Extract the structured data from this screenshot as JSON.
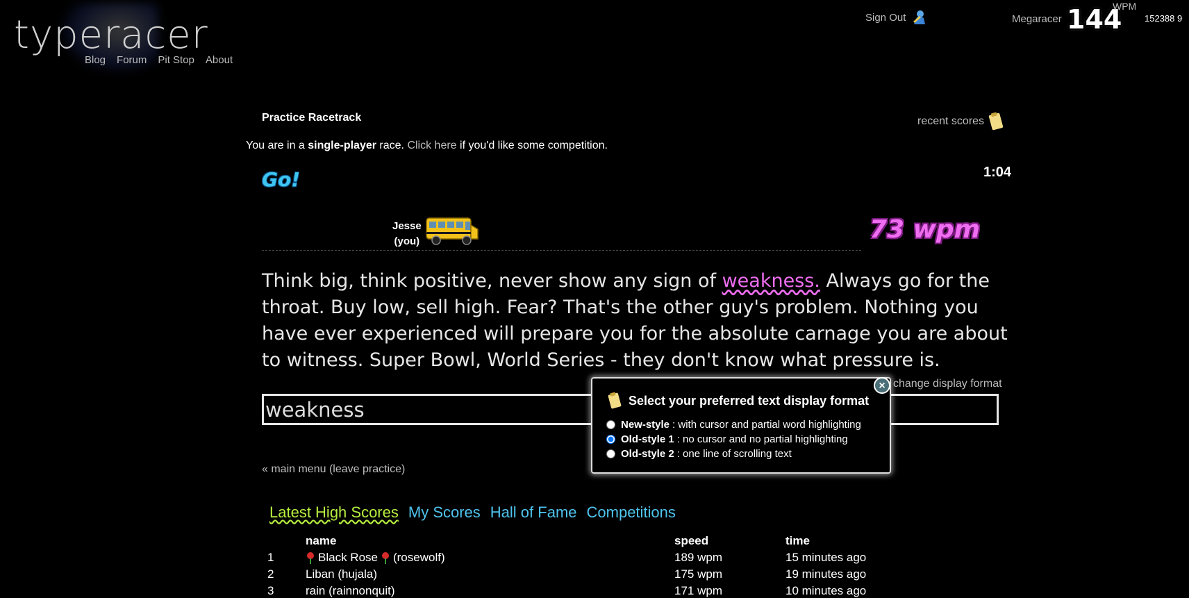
{
  "header": {
    "logo": "typeracer",
    "nav": [
      "Blog",
      "Forum",
      "Pit Stop",
      "About"
    ],
    "sign_out": "Sign Out",
    "username": "Megaracer",
    "wpm_value": "144",
    "wpm_label": "WPM",
    "points": "152388  9"
  },
  "race": {
    "title": "Practice Racetrack",
    "recent_scores": "recent scores",
    "single_prefix": "You are in a ",
    "single_bold": "single-player",
    "single_mid": " race. ",
    "click_here": "Click here",
    "single_suffix": " if you'd like some competition.",
    "go": "Go!",
    "timer": "1:04",
    "racer_name": "Jesse",
    "racer_you": "(you)",
    "speed": "73 wpm",
    "passage_before": "Think big, think positive, never show any sign of ",
    "passage_current": "weakness.",
    "passage_after": " Always go for the throat. Buy low, sell high. Fear? That's the other guy's problem. Nothing you have ever experienced will prepare you for the absolute carnage you are about to witness. Super Bowl, World Series - they don't know what pressure is.",
    "change_format": "change display format",
    "input_value": "weakness",
    "leave": "« main menu (leave practice)"
  },
  "format_popup": {
    "title": "Select your preferred text display format",
    "options": [
      {
        "name": "New-style",
        "desc": ": with cursor and partial word highlighting",
        "selected": false
      },
      {
        "name": "Old-style 1",
        "desc": ": no cursor and no partial highlighting",
        "selected": true
      },
      {
        "name": "Old-style 2",
        "desc": ": one line of scrolling text",
        "selected": false
      }
    ],
    "close": "×"
  },
  "scores": {
    "tabs": [
      "Latest High Scores",
      "My Scores",
      "Hall of Fame",
      "Competitions"
    ],
    "columns": [
      "name",
      "speed",
      "time"
    ],
    "rows": [
      {
        "rank": "1",
        "name": "Black Rose",
        "handle": "(rosewolf)",
        "speed": "189 wpm",
        "time": "15 minutes ago"
      },
      {
        "rank": "2",
        "name": "Liban (hujala)",
        "handle": "",
        "speed": "175 wpm",
        "time": "19 minutes ago"
      },
      {
        "rank": "3",
        "name": "rain (rainnonquit)",
        "handle": "",
        "speed": "171 wpm",
        "time": "10 minutes ago"
      }
    ]
  },
  "colors": {
    "background": "#000000",
    "go": "#3ec6f0",
    "speed": "#ef6df0",
    "active_tab": "#b7ef3f",
    "tab": "#4fc4ee"
  }
}
